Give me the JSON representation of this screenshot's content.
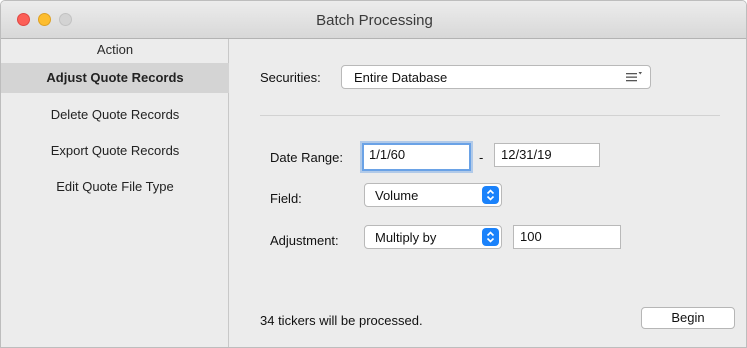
{
  "window": {
    "title": "Batch Processing"
  },
  "sidebar": {
    "header": "Action",
    "items": [
      {
        "label": "Adjust Quote Records",
        "selected": true
      },
      {
        "label": "Delete Quote Records",
        "selected": false
      },
      {
        "label": "Export Quote Records",
        "selected": false
      },
      {
        "label": "Edit Quote File Type",
        "selected": false
      }
    ]
  },
  "form": {
    "securities_label": "Securities:",
    "securities_value": "Entire Database",
    "date_range_label": "Date Range:",
    "date_from": "1/1/60",
    "date_separator": "-",
    "date_to": "12/31/19",
    "field_label": "Field:",
    "field_value": "Volume",
    "adjustment_label": "Adjustment:",
    "adjustment_value": "Multiply by",
    "adjustment_amount": "100"
  },
  "footer": {
    "status": "34 tickers will be processed.",
    "begin_label": "Begin"
  },
  "colors": {
    "accent": "#1a82fb",
    "focus_ring": "#6aa2e6",
    "close": "#fc5f57",
    "minimize": "#fdbd2e"
  }
}
